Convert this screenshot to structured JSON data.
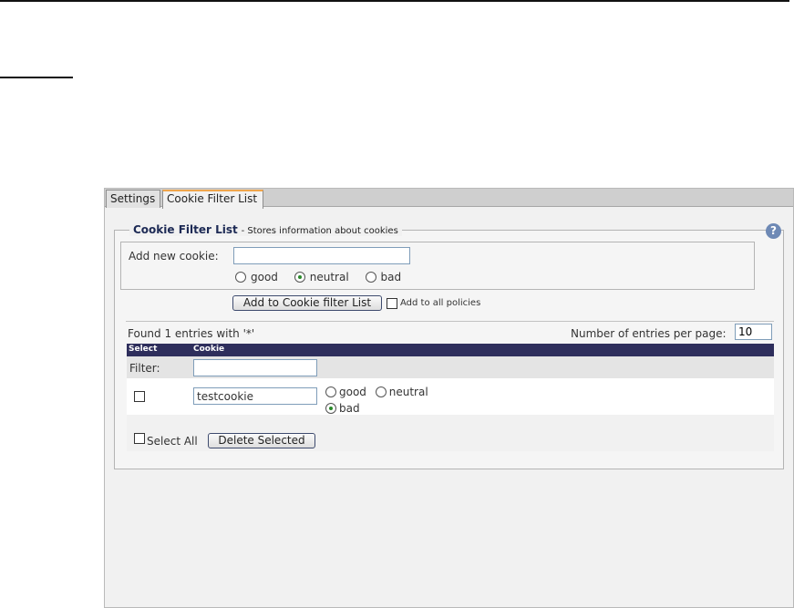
{
  "tabs": [
    {
      "label": "Settings",
      "active": false
    },
    {
      "label": "Cookie Filter List",
      "active": true
    }
  ],
  "section": {
    "title": "Cookie Filter List",
    "subtitle": "- Stores information about cookies",
    "help_icon": "question-mark-icon"
  },
  "add_form": {
    "label": "Add new cookie:",
    "input_value": "",
    "options": [
      {
        "label": "good",
        "selected": false
      },
      {
        "label": "neutral",
        "selected": true
      },
      {
        "label": "bad",
        "selected": false
      }
    ],
    "add_button": "Add to Cookie filter List",
    "all_policies_label": "Add to all policies",
    "all_policies_checked": false
  },
  "list": {
    "found_text": "Found 1 entries with '*'",
    "per_page_label": "Number of entries per page:",
    "per_page_value": "10",
    "columns": [
      "Select",
      "Cookie"
    ],
    "filter_label": "Filter:",
    "filter_value": "",
    "rows": [
      {
        "selected": false,
        "cookie": "testcookie",
        "options": [
          {
            "label": "good",
            "selected": false
          },
          {
            "label": "neutral",
            "selected": false
          },
          {
            "label": "bad",
            "selected": true
          }
        ]
      }
    ],
    "select_all_label": "Select All",
    "delete_button": "Delete Selected"
  },
  "colors": {
    "header_bg": "#2e2e5c",
    "active_tab_accent": "#f0a64c",
    "selected_radio": "#2a8a2a",
    "help_icon": "#6e89b5"
  }
}
